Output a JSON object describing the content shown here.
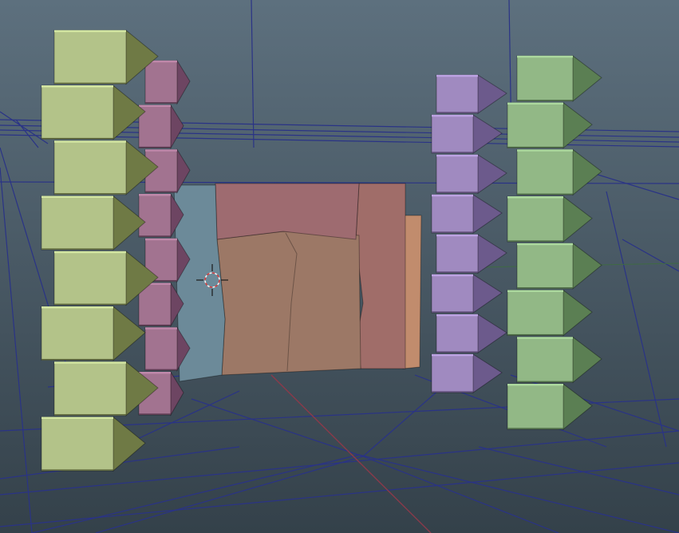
{
  "viewport": {
    "colors": {
      "bg_top": "#5d707e",
      "bg_bottom": "#34414a",
      "wire": "#2a3386",
      "axis_red": "#8a3a4a",
      "axis_green": "#3f6a44",
      "cursor_red": "#d84040",
      "cursor_white": "#f2f2f2"
    }
  },
  "objects": [
    {
      "id": "pillar-olive",
      "color": "#b3c389",
      "dark": "#6f7a45"
    },
    {
      "id": "pillar-mauve",
      "color": "#a27390",
      "dark": "#6d4562"
    },
    {
      "id": "wall-blue",
      "color": "#6c8a99"
    },
    {
      "id": "wall-rose-top",
      "color": "#9e6b70"
    },
    {
      "id": "wall-tan",
      "color": "#9c7866"
    },
    {
      "id": "wall-rose-right",
      "color": "#a06d69"
    },
    {
      "id": "panel-peach",
      "color": "#c18c6d"
    },
    {
      "id": "pillar-lavender",
      "color": "#a08ac0",
      "dark": "#6c5a8c"
    },
    {
      "id": "pillar-green",
      "color": "#92b886",
      "dark": "#5b7f53"
    }
  ]
}
